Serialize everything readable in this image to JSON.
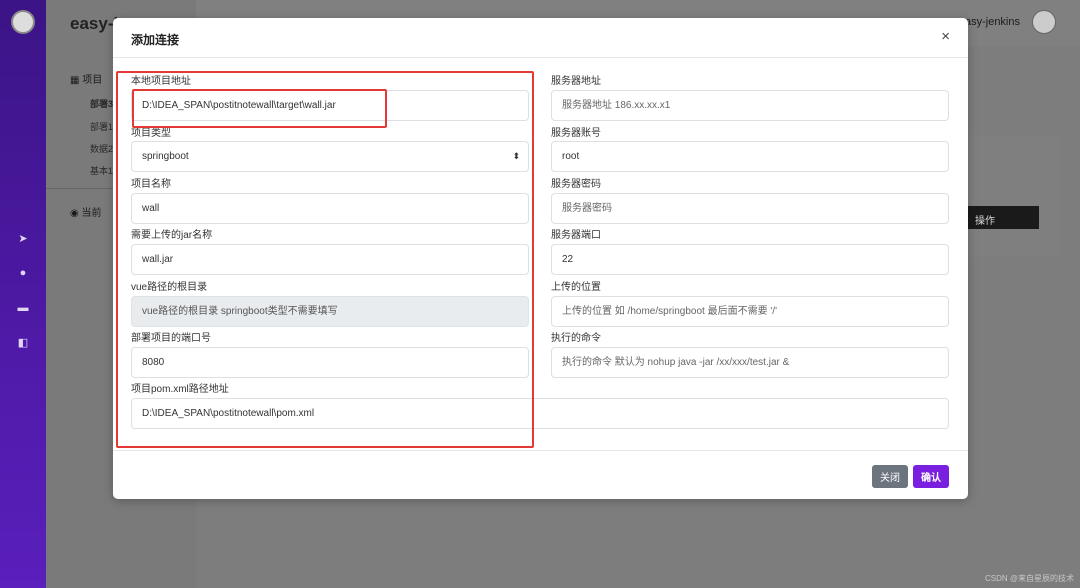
{
  "background": {
    "brand": "easy-je",
    "sidebar_section": "项目",
    "sidebar_subitems": [
      "部署3",
      "部署1",
      "数据2",
      "基本1"
    ],
    "sidebar_section2": "当前",
    "user_name": "easy-jenkins",
    "operation_button": "操作"
  },
  "modal": {
    "title": "添加连接",
    "close_symbol": "×",
    "left": {
      "local_path": {
        "label": "本地项目地址",
        "value": "D:\\IDEA_SPAN\\postitnotewall\\target\\wall.jar"
      },
      "project_type": {
        "label": "项目类型",
        "value": "springboot",
        "options": [
          "springboot"
        ]
      },
      "project_name": {
        "label": "项目名称",
        "value": "wall"
      },
      "jar_name": {
        "label": "需要上传的jar名称",
        "value": "wall.jar"
      },
      "vue_root": {
        "label": "vue路径的根目录",
        "placeholder": "vue路径的根目录 springboot类型不需要填写"
      },
      "deploy_port": {
        "label": "部署项目的端口号",
        "value": "8080"
      },
      "pom_path": {
        "label": "项目pom.xml路径地址",
        "value": "D:\\IDEA_SPAN\\postitnotewall\\pom.xml"
      }
    },
    "right": {
      "server_address": {
        "label": "服务器地址",
        "placeholder": "服务器地址 186.xx.xx.x1"
      },
      "server_account": {
        "label": "服务器账号",
        "value": "root"
      },
      "server_password": {
        "label": "服务器密码",
        "placeholder": "服务器密码"
      },
      "server_port": {
        "label": "服务器端口",
        "value": "22"
      },
      "upload_location": {
        "label": "上传的位置",
        "placeholder": "上传的位置 如 /home/springboot  最后面不需要 '/'"
      },
      "exec_command": {
        "label": "执行的命令",
        "placeholder": "执行的命令 默认为 nohup java -jar /xx/xxx/test.jar &"
      }
    },
    "footer": {
      "close_label": "关闭",
      "confirm_label": "确认"
    }
  },
  "colors": {
    "accent": "#7a1fe0",
    "highlight": "#e53935",
    "secondary_button": "#6c757d"
  }
}
